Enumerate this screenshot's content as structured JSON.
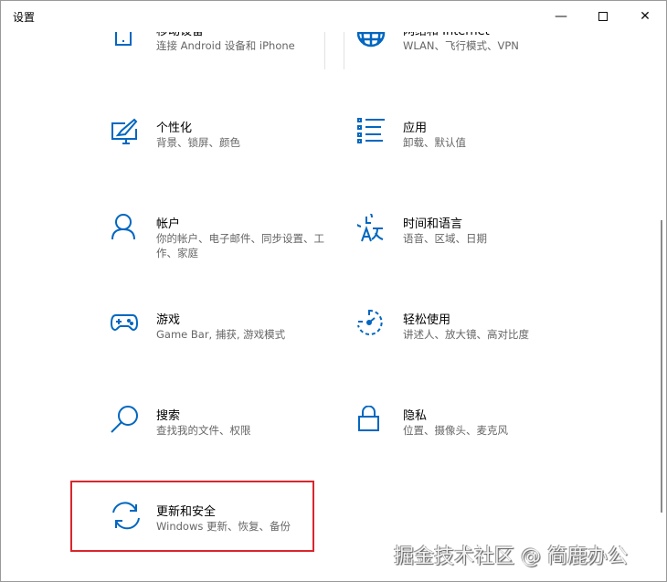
{
  "window": {
    "title": "设置"
  },
  "items": [
    {
      "name": "移动设备",
      "desc": "连接 Android 设备和 iPhone",
      "icon": "phone-icon"
    },
    {
      "name": "网络和 Internet",
      "desc": "WLAN、飞行模式、VPN",
      "icon": "globe-icon"
    },
    {
      "name": "个性化",
      "desc": "背景、锁屏、颜色",
      "icon": "personalization-icon"
    },
    {
      "name": "应用",
      "desc": "卸载、默认值",
      "icon": "apps-list-icon"
    },
    {
      "name": "帐户",
      "desc": "你的帐户、电子邮件、同步设置、工作、家庭",
      "icon": "person-icon"
    },
    {
      "name": "时间和语言",
      "desc": "语音、区域、日期",
      "icon": "time-language-icon"
    },
    {
      "name": "游戏",
      "desc": "Game Bar, 捕获, 游戏模式",
      "icon": "gamepad-icon"
    },
    {
      "name": "轻松使用",
      "desc": "讲述人、放大镜、高对比度",
      "icon": "ease-of-access-icon"
    },
    {
      "name": "搜索",
      "desc": "查找我的文件、权限",
      "icon": "search-icon"
    },
    {
      "name": "隐私",
      "desc": "位置、摄像头、麦克风",
      "icon": "lock-icon"
    },
    {
      "name": "更新和安全",
      "desc": "Windows 更新、恢复、备份",
      "icon": "sync-icon"
    }
  ],
  "watermark": "掘金技术社区 @ 简鹿办公",
  "colors": {
    "accent": "#0067c0",
    "highlight": "#d9262c"
  }
}
